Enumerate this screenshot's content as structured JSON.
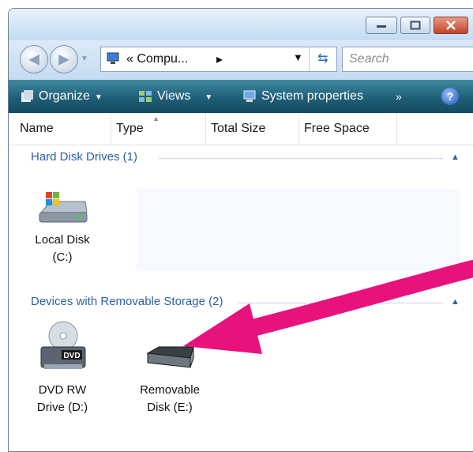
{
  "window": {
    "address": {
      "crumb": "« Compu...",
      "crumb_separator": "▸"
    },
    "search": {
      "placeholder": "Search"
    },
    "toolbar": {
      "organize_label": "Organize",
      "views_label": "Views",
      "system_properties_label": "System properties",
      "more_label": "»",
      "help_label": "?"
    },
    "columns": [
      "Name",
      "Type",
      "Total Size",
      "Free Space"
    ],
    "groups": [
      {
        "title": "Hard Disk Drives (1)",
        "items": [
          {
            "label_line1": "Local Disk",
            "label_line2": "(C:)"
          }
        ]
      },
      {
        "title": "Devices with Removable Storage (2)",
        "items": [
          {
            "label_line1": "DVD RW",
            "label_line2": "Drive (D:)",
            "badge": "DVD"
          },
          {
            "label_line1": "Removable",
            "label_line2": "Disk (E:)"
          }
        ]
      }
    ]
  },
  "colors": {
    "toolbar": "#1f5f77",
    "group_title": "#2f5fa5",
    "annotation_arrow": "#e8127d",
    "close_button": "#c4432a"
  }
}
